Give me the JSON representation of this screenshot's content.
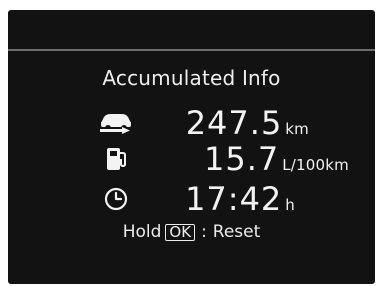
{
  "screen": {
    "title": "Accumulated Info"
  },
  "metrics": {
    "distance": {
      "value": "247.5",
      "unit": "km",
      "icon": "car-route-icon"
    },
    "fuel": {
      "value": "15.7",
      "unit": "L/100km",
      "icon": "fuel-pump-icon"
    },
    "time": {
      "value": "17:42",
      "unit": "h",
      "icon": "clock-icon"
    }
  },
  "footer": {
    "hold_text": "Hold",
    "ok_text": "OK",
    "colon": ":",
    "action_text": "Reset"
  },
  "colors": {
    "background": "#121212",
    "divider": "#6d6d6d",
    "text": "#f3f3f3"
  }
}
